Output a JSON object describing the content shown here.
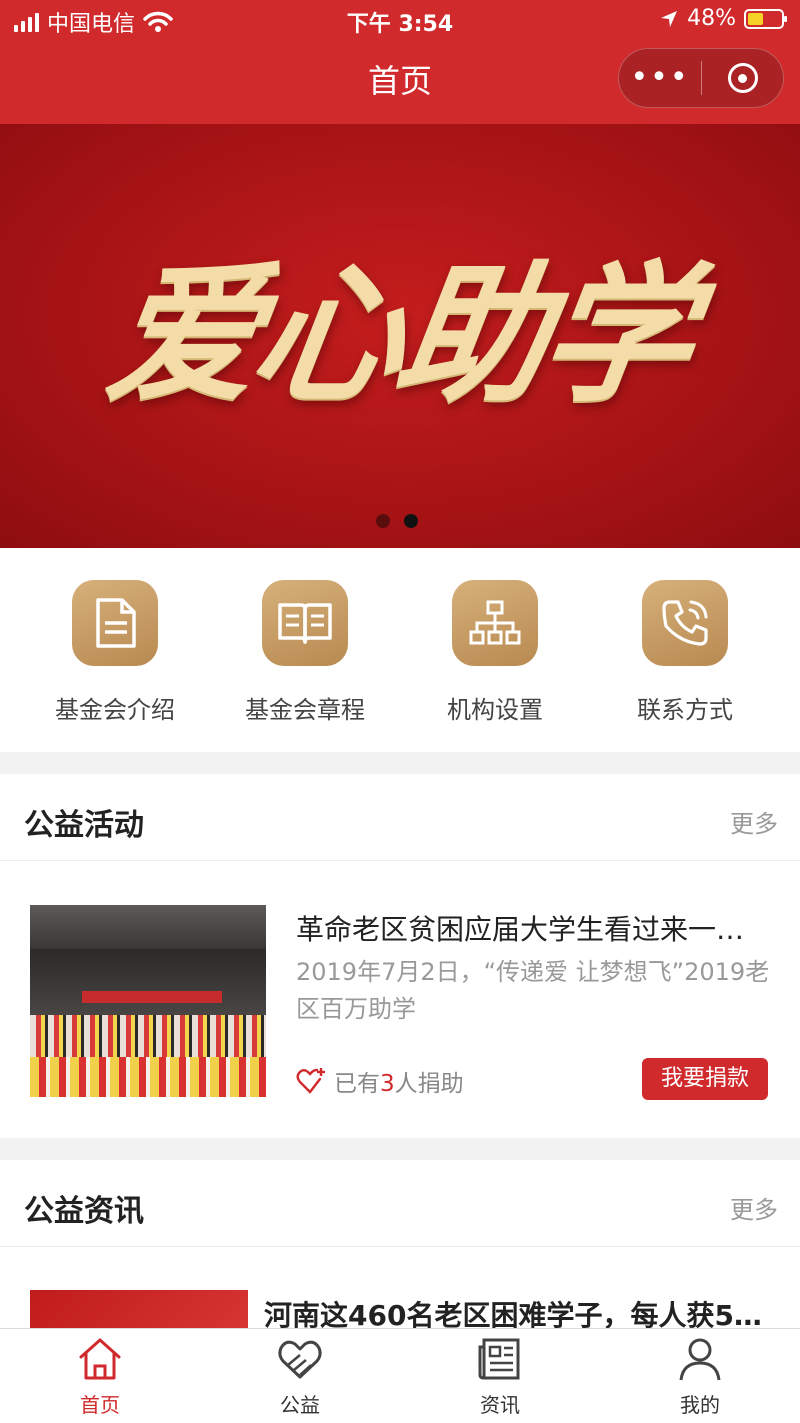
{
  "status_bar": {
    "carrier": "中国电信",
    "time": "下午 3:54",
    "battery": "48%",
    "battery_level": 0.48
  },
  "nav": {
    "title": "首页",
    "more": "•••"
  },
  "banner": {
    "text": "爱心助学",
    "slide_count": 2,
    "active_slide": 2
  },
  "quick_links": [
    {
      "label": "基金会介绍",
      "icon": "document-icon"
    },
    {
      "label": "基金会章程",
      "icon": "book-icon"
    },
    {
      "label": "机构设置",
      "icon": "org-chart-icon"
    },
    {
      "label": "联系方式",
      "icon": "phone-icon"
    }
  ],
  "activities": {
    "title": "公益活动",
    "more": "更多",
    "items": [
      {
        "title": "革命老区贫困应届大学生看过来一…",
        "desc": "2019年7月2日，“传递爱 让梦想飞”2019老区百万助学",
        "donated_prefix": "已有",
        "donated_count": "3",
        "donated_suffix": "人捐助",
        "button": "我要捐款"
      }
    ]
  },
  "news": {
    "title": "公益资讯",
    "more": "更多",
    "items": [
      {
        "title": "河南这460名老区困难学子，每人获5…"
      }
    ]
  },
  "tabs": [
    {
      "label": "首页",
      "icon": "home-icon",
      "active": true
    },
    {
      "label": "公益",
      "icon": "charity-heart-icon",
      "active": false
    },
    {
      "label": "资讯",
      "icon": "news-icon",
      "active": false
    },
    {
      "label": "我的",
      "icon": "user-icon",
      "active": false
    }
  ],
  "colors": {
    "primary": "#d12a2c",
    "gold": "#c59a62",
    "banner_text": "#f3dca8"
  }
}
